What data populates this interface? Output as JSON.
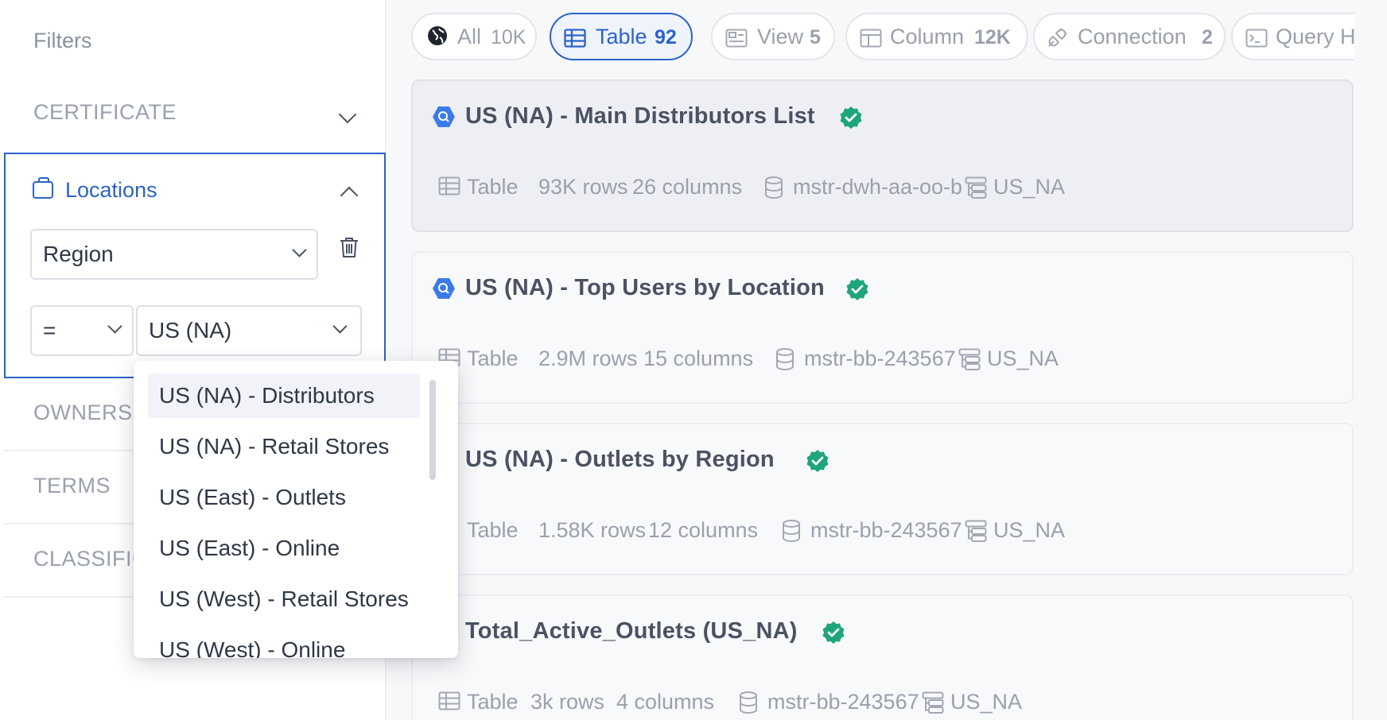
{
  "sidebar": {
    "title": "Filters",
    "certificate_label": "CERTIFICATE",
    "locations": {
      "label": "Locations",
      "field_select": "Region",
      "operator_select": "=",
      "value_select": "US (NA)"
    },
    "owners_label": "OWNERS",
    "terms_label": "TERMS",
    "classification_label": "CLASSIFIC"
  },
  "dropdown": {
    "options": [
      "US (NA) - Distributors",
      "US (NA) - Retail Stores",
      "US (East) - Outlets",
      "US (East) - Online",
      "US (West) - Retail Stores",
      "US (West) - Online"
    ]
  },
  "tabs": [
    {
      "label": "All",
      "count": "10K",
      "icon": "globe-icon"
    },
    {
      "label": "Table",
      "count": "92",
      "icon": "table-icon",
      "active": true
    },
    {
      "label": "View",
      "count": "5",
      "icon": "view-icon"
    },
    {
      "label": "Column",
      "count": "12K",
      "icon": "column-icon"
    },
    {
      "label": "Connection",
      "count": "2",
      "icon": "plug-icon"
    },
    {
      "label": "Query H",
      "count": "",
      "icon": "terminal-icon"
    }
  ],
  "results": [
    {
      "title": "US (NA) - Main Distributors List",
      "type": "Table",
      "rows": "93K rows",
      "columns": "26 columns",
      "database": "mstr-dwh-aa-oo-b",
      "schema": "US_NA"
    },
    {
      "title": "US (NA) - Top Users by Location",
      "type": "Table",
      "rows": "2.9M rows",
      "columns": "15 columns",
      "database": "mstr-bb-243567",
      "schema": "US_NA"
    },
    {
      "title": "US (NA) - Outlets by Region",
      "type": "Table",
      "rows": "1.58K rows",
      "columns": "12 columns",
      "database": "mstr-bb-243567",
      "schema": "US_NA"
    },
    {
      "title": "Total_Active_Outlets (US_NA)",
      "type": "Table",
      "rows": "3k rows",
      "columns": "4 columns",
      "database": "mstr-bb-243567",
      "schema": "US_NA"
    }
  ],
  "colors": {
    "accent": "#2c63c9",
    "verified": "#1fa57a",
    "badge": "#3b7be8"
  }
}
